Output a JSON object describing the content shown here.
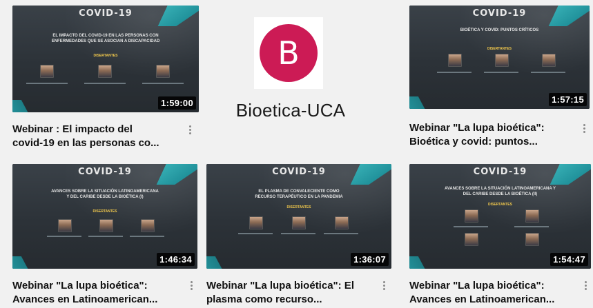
{
  "channel": {
    "avatar_letter": "B",
    "name": "Bioetica-UCA",
    "avatar_color": "#cc1b55"
  },
  "videos": [
    {
      "duration": "1:59:00",
      "title_line1": "Webinar : El impacto del",
      "title_line2": "covid-19 en las personas co...",
      "thumb": {
        "brand": "COVID-19",
        "headline": "EL IMPACTO DEL COVID-19 EN LAS PERSONAS CON\nENFERMEDADES QUE SE ASOCIAN A DISCAPACIDAD",
        "section": "DISERTANTES"
      }
    },
    {
      "duration": "1:57:15",
      "title_line1": "Webinar \"La lupa bioética\":",
      "title_line2": "Bioética y covid: puntos...",
      "thumb": {
        "brand": "COVID-19",
        "headline": "BIOÉTICA Y COVID: PUNTOS CRÍTICOS",
        "section": "DISERTANTES"
      }
    },
    {
      "duration": "1:46:34",
      "title_line1": "Webinar \"La lupa bioética\":",
      "title_line2": "Avances en Latinoamerican...",
      "thumb": {
        "brand": "COVID-19",
        "headline": "AVANCES SOBRE LA SITUACIÓN LATINOAMERICANA\nY DEL CARIBE DESDE LA BIOÉTICA (I)",
        "section": "DISERTANTES"
      }
    },
    {
      "duration": "1:36:07",
      "title_line1": "Webinar \"La lupa bioética\": El",
      "title_line2": "plasma como recurso...",
      "thumb": {
        "brand": "COVID-19",
        "headline": "EL PLASMA DE CONVALECIENTE COMO\nRECURSO TERAPÉUTICO EN LA PANDEMIA",
        "section": "DISERTANTES"
      }
    },
    {
      "duration": "1:54:47",
      "title_line1": "Webinar \"La lupa bioética\":",
      "title_line2": "Avances en Latinoamerican...",
      "thumb": {
        "brand": "COVID-19",
        "headline": "AVANCES SOBRE LA SITUACIÓN LATINOAMERICANA Y\nDEL CARIBE DESDE LA BIOÉTICA (II)",
        "section": "DISERTANTES"
      }
    }
  ]
}
